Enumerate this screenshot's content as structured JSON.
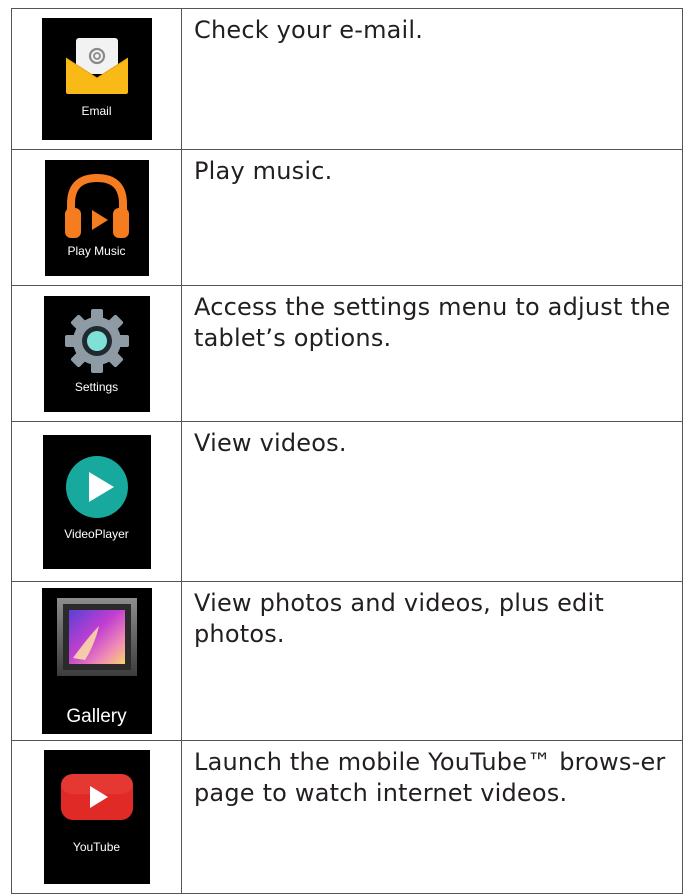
{
  "rows": [
    {
      "app": "Email",
      "icon": "email-envelope-icon",
      "description": "Check your e-mail."
    },
    {
      "app": "Play Music",
      "icon": "headphones-icon",
      "description": "Play music."
    },
    {
      "app": "Settings",
      "icon": "gear-icon",
      "description": "Access the settings menu to adjust the tablet’s options."
    },
    {
      "app": "VideoPlayer",
      "icon": "play-circle-icon",
      "description": "View  videos."
    },
    {
      "app": "Gallery",
      "icon": "photo-frame-icon",
      "description": "View photos and videos, plus edit photos."
    },
    {
      "app": "YouTube",
      "icon": "youtube-play-icon",
      "description": "Launch the mobile YouTube™ brows-er page to watch internet videos."
    }
  ],
  "colors": {
    "email_yellow": "#f9b916",
    "music_orange": "#f57c1f",
    "settings_gray": "#8e9ba5",
    "settings_teal": "#7fe0d6",
    "video_teal": "#17a99e",
    "youtube_red": "#e02a26"
  }
}
